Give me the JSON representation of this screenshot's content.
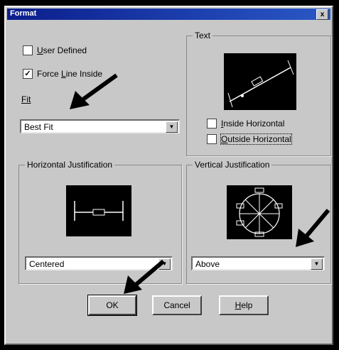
{
  "window": {
    "title": "Format",
    "close_glyph": "x"
  },
  "options": {
    "user_defined": {
      "label_pre": "",
      "label_u": "U",
      "label_post": "ser Defined",
      "checked": false
    },
    "force_line_inside": {
      "label_pre": "Force ",
      "label_u": "L",
      "label_post": "ine Inside",
      "checked": true,
      "mark": "✓"
    }
  },
  "fit": {
    "label": "Fit",
    "value": "Best Fit"
  },
  "text_group": {
    "title": "Text",
    "inside_horizontal": {
      "label_pre": "",
      "label_u": "I",
      "label_post": "nside Horizontal",
      "checked": false
    },
    "outside_horizontal": {
      "label_pre": "",
      "label_u": "O",
      "label_post": "utside Horizontal",
      "checked": false
    }
  },
  "horizontal_justification": {
    "title": "Horizontal Justification",
    "value": "Centered"
  },
  "vertical_justification": {
    "title": "Vertical Justification",
    "value": "Above"
  },
  "buttons": {
    "ok": "OK",
    "cancel": "Cancel",
    "help": "Help"
  },
  "dropdown_glyph": "▼",
  "colors": {
    "titlebar": "#0a1e8c",
    "dialog": "#c8c8c8",
    "arrows": "#000000"
  },
  "icons": [
    "close-icon",
    "chevron-down-icon",
    "pointer-arrow-icon"
  ]
}
